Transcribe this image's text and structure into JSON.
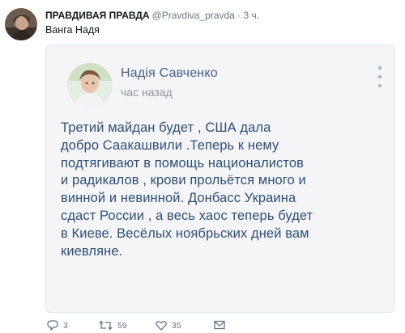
{
  "tweet": {
    "author_name": "ПРАВДИВАЯ ПРАВДА",
    "author_handle": "@Pravdiva_pravda · 3 ч.",
    "text": "Ванга Надя",
    "card": {
      "name": "Надія Савченко",
      "time": "час назад",
      "lines": [
        "Третий майдан будет , США дала",
        "добро Саакашвили .Теперь к нему",
        "подтягивают в помощь  националистов",
        "и радикалов , крови прольётся много и",
        "винной и невинной.  Донбасс Украина",
        "сдаст России , а весь хаос теперь будет",
        "в Киеве. Весёлых ноябрьских дней вам",
        "киевляне."
      ]
    },
    "actions": {
      "reply_count": "3",
      "retweet_count": "59",
      "like_count": "35"
    }
  },
  "icons": {
    "reply": "reply-icon",
    "retweet": "retweet-icon",
    "like": "heart-icon",
    "dm": "envelope-icon",
    "menu": "more-vertical-icon"
  },
  "colors": {
    "card_name": "#41628a",
    "card_text": "#2d4f75",
    "meta": "#657786"
  }
}
